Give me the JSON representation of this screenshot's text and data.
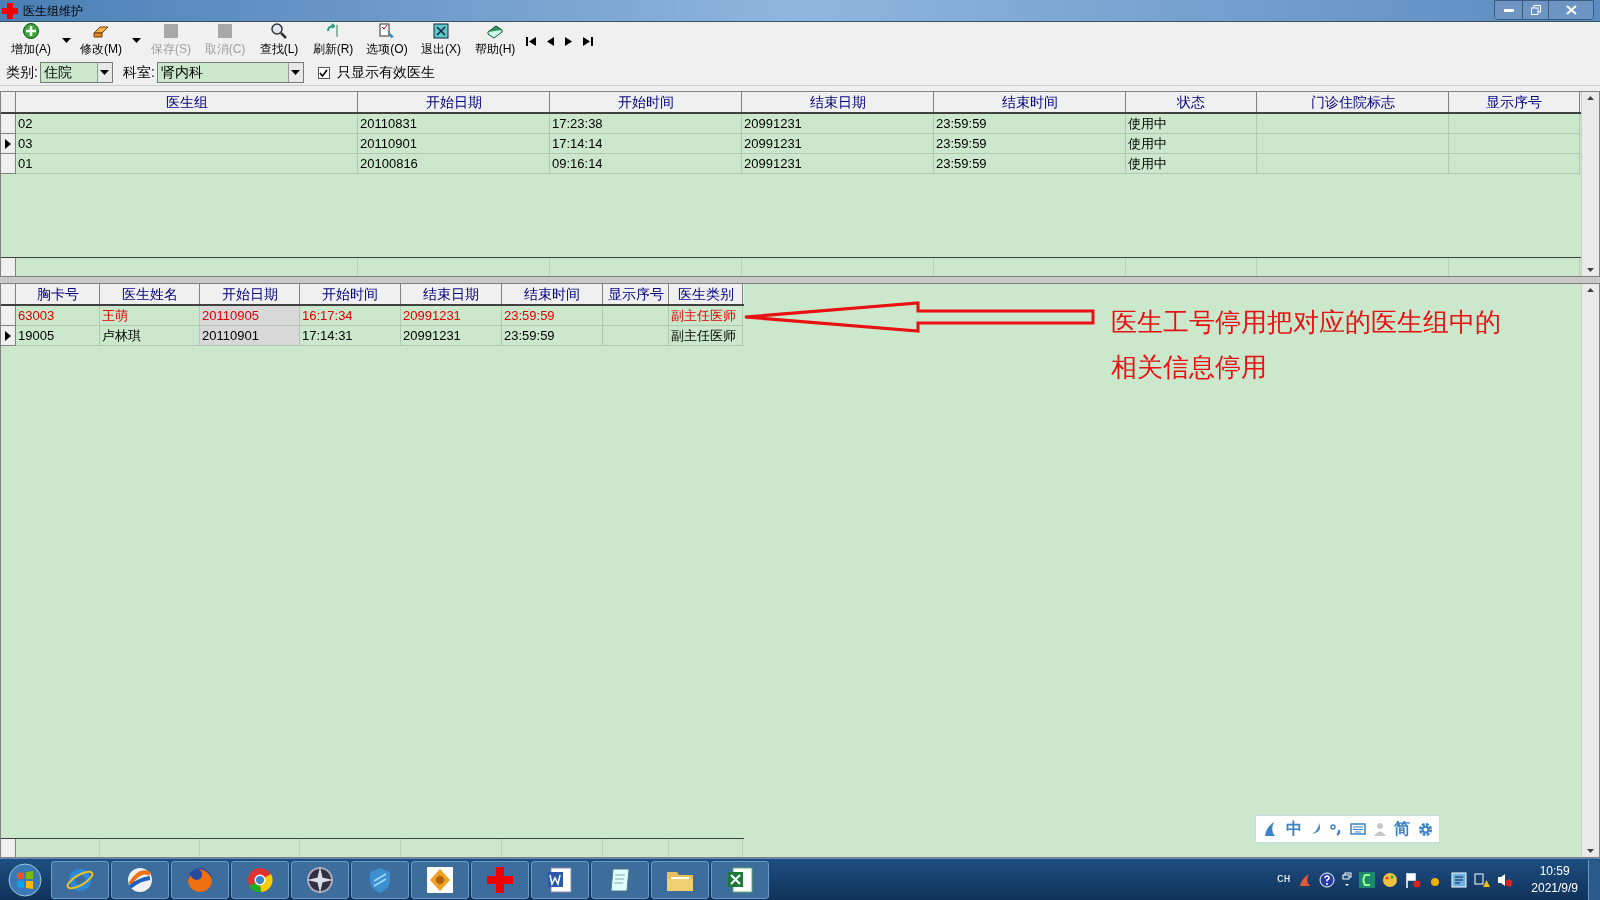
{
  "window": {
    "title": "医生组维护"
  },
  "toolbar": [
    {
      "kind": "add",
      "label": "增加(A)",
      "disabled": false,
      "dropdown": true
    },
    {
      "kind": "edit",
      "label": "修改(M)",
      "disabled": false,
      "dropdown": true
    },
    {
      "kind": "save",
      "label": "保存(S)",
      "disabled": true,
      "dropdown": false
    },
    {
      "kind": "cancel",
      "label": "取消(C)",
      "disabled": true,
      "dropdown": false
    },
    {
      "kind": "find",
      "label": "查找(L)",
      "disabled": false,
      "dropdown": false
    },
    {
      "kind": "refresh",
      "label": "刷新(R)",
      "disabled": false,
      "dropdown": false
    },
    {
      "kind": "options",
      "label": "选项(O)",
      "disabled": false,
      "dropdown": false
    },
    {
      "kind": "exit",
      "label": "退出(X)",
      "disabled": false,
      "dropdown": false
    },
    {
      "kind": "help",
      "label": "帮助(H)",
      "disabled": false,
      "dropdown": false
    }
  ],
  "filters": {
    "category": {
      "label": "类别:",
      "value": "住院"
    },
    "department": {
      "label": "科室:",
      "value": "肾内科"
    },
    "active_only": {
      "label": "只显示有效医生",
      "checked": true
    }
  },
  "groups_table": {
    "columns": [
      "医生组",
      "开始日期",
      "开始时间",
      "结束日期",
      "结束时间",
      "状态",
      "门诊住院标志",
      "显示序号"
    ],
    "rows": [
      {
        "selected": false,
        "cells": [
          "02",
          "20110831",
          "17:23:38",
          "20991231",
          "23:59:59",
          "使用中"
        ]
      },
      {
        "selected": true,
        "cells": [
          "03",
          "20110901",
          "17:14:14",
          "20991231",
          "23:59:59",
          "使用中"
        ]
      },
      {
        "selected": false,
        "cells": [
          "01",
          "20100816",
          "09:16:14",
          "20991231",
          "23:59:59",
          "使用中"
        ]
      }
    ]
  },
  "doctors_table": {
    "columns": [
      "胸卡号",
      "医生姓名",
      "开始日期",
      "开始时间",
      "结束日期",
      "结束时间",
      "显示序号",
      "医生类别"
    ],
    "rows": [
      {
        "selected": false,
        "disabled": true,
        "cells": [
          "63003",
          "王萌",
          "20110905",
          "16:17:34",
          "20991231",
          "23:59:59",
          "",
          "副主任医师"
        ]
      },
      {
        "selected": true,
        "disabled": false,
        "cells": [
          "19005",
          "卢林琪",
          "20110901",
          "17:14:31",
          "20991231",
          "23:59:59",
          "",
          "副主任医师"
        ]
      }
    ]
  },
  "annotation": {
    "text": "医生工号停用把对应的医生组中的相关信息停用"
  },
  "ime_bar": {
    "mode": "中",
    "script": "简"
  },
  "tray": {
    "language": "CH",
    "time": "10:59",
    "date": "2021/9/9"
  }
}
